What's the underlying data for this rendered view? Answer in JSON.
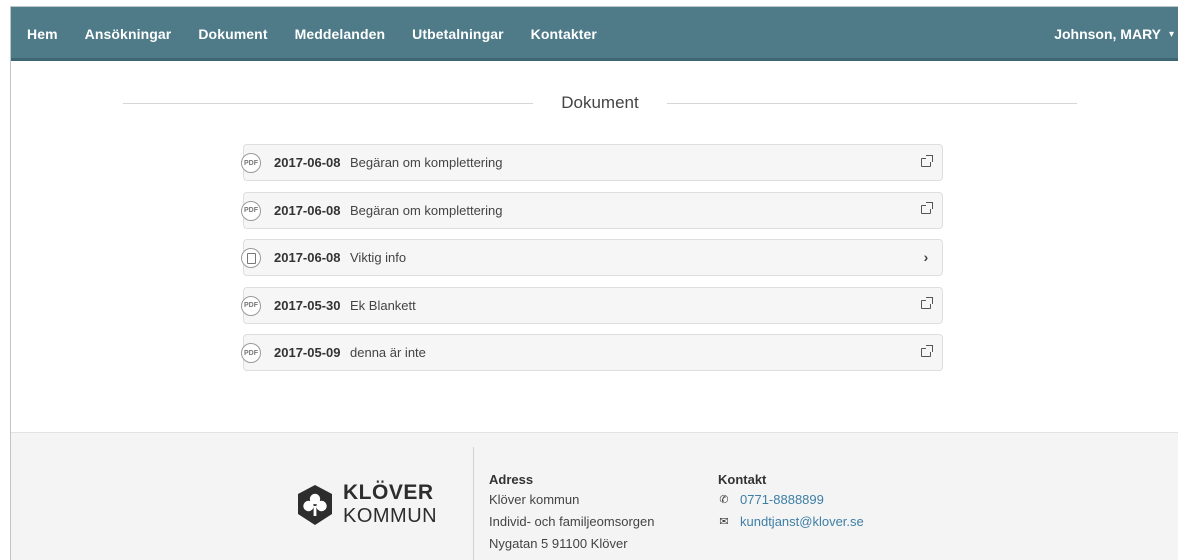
{
  "nav": {
    "items": [
      {
        "label": "Hem"
      },
      {
        "label": "Ansökningar"
      },
      {
        "label": "Dokument"
      },
      {
        "label": "Meddelanden"
      },
      {
        "label": "Utbetalningar"
      },
      {
        "label": "Kontakter"
      }
    ],
    "user": "Johnson, MARY"
  },
  "main": {
    "section_title": "Dokument",
    "documents": [
      {
        "date": "2017-06-08",
        "title": "Begäran om komplettering",
        "type": "pdf",
        "action": "external-link-icon"
      },
      {
        "date": "2017-06-08",
        "title": "Begäran om komplettering",
        "type": "pdf",
        "action": "external-link-icon"
      },
      {
        "date": "2017-06-08",
        "title": "Viktig info",
        "type": "document",
        "action": "chevron-right-icon"
      },
      {
        "date": "2017-05-30",
        "title": "Ek Blankett",
        "type": "pdf",
        "action": "external-link-icon"
      },
      {
        "date": "2017-05-09",
        "title": "denna är inte",
        "type": "pdf",
        "action": "external-link-icon"
      }
    ],
    "pdf_icon_text": "PDF"
  },
  "footer": {
    "logo": {
      "line1": "KLÖVER",
      "line2": "KOMMUN"
    },
    "address": {
      "heading": "Adress",
      "lines": [
        "Klöver kommun",
        "Individ- och familjeomsorgen",
        "Nygatan 5 91100 Klöver"
      ]
    },
    "contact": {
      "heading": "Kontakt",
      "phone": "0771-8888899",
      "email": "kundtjanst@klover.se"
    }
  },
  "colors": {
    "navbar": "#4f7b89",
    "link": "#3d7fa6",
    "footer_bg": "#f4f4f4"
  }
}
